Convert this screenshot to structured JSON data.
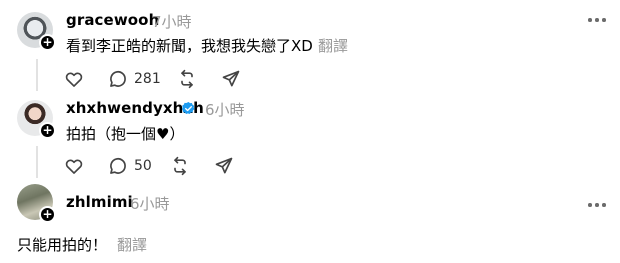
{
  "posts": [
    {
      "username": "gracewooh",
      "time": "7小時",
      "text": "看到李正皓的新聞，我想我失戀了XD",
      "translate": "翻譯",
      "replies": "281"
    },
    {
      "username": "xhxhwendyxhxh",
      "time": "6小時",
      "verified": true,
      "text": "拍拍（抱一個♥）",
      "replies": "50"
    },
    {
      "username": "zhlmimi",
      "time": "6小時",
      "text": "只能用拍的！",
      "translate": "翻譯"
    }
  ],
  "icons": {
    "like": "heart-icon",
    "reply": "comment-icon",
    "repost": "repost-icon",
    "share": "share-icon",
    "more": "more-icon",
    "verified": "verified-badge-icon",
    "follow": "plus-icon"
  },
  "colors": {
    "verified": "#1d9bf0",
    "muted": "#999999",
    "thread_line": "#e2e2e2"
  }
}
